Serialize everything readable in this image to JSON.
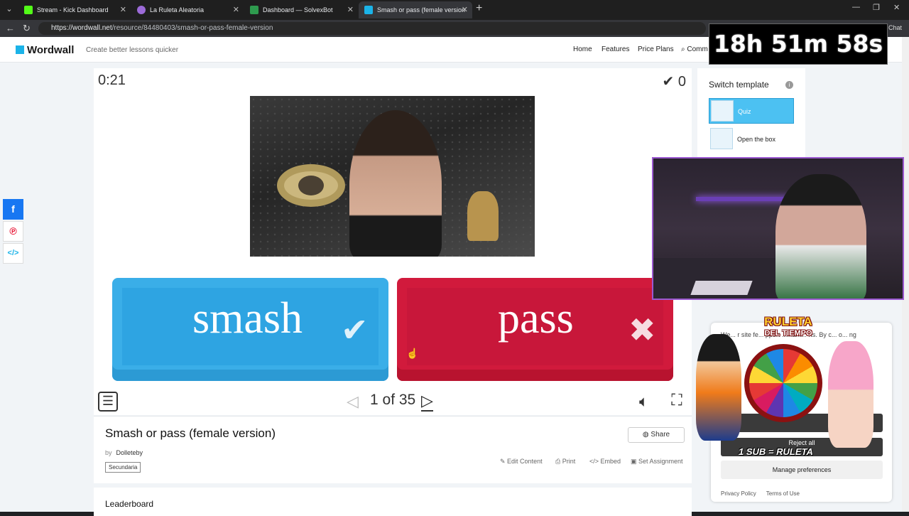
{
  "browser": {
    "tabs": [
      {
        "title": "Stream - Kick Dashboard",
        "color": "#53fc18"
      },
      {
        "title": "La Ruleta Aleatoria",
        "color": "#9c6bd8"
      },
      {
        "title": "Dashboard — SolvexBot",
        "color": "#2e9b4e"
      },
      {
        "title": "Smash or pass (female version",
        "color": "#1bb3e8"
      }
    ],
    "url_host": "https://wordwall.net",
    "url_path": "/resource/84480403/smash-or-pass-female-version",
    "chat_label": "Chat"
  },
  "header": {
    "logo": "Wordwall",
    "tagline": "Create better lessons quicker",
    "menu": [
      "Home",
      "Features",
      "Price Plans",
      "Comm"
    ]
  },
  "activity": {
    "timer": "0:21",
    "score": "0",
    "smash_label": "smash",
    "pass_label": "pass",
    "pager": "1 of 35"
  },
  "resource": {
    "title": "Smash or pass (female version)",
    "by_prefix": "by",
    "author": "Dolleteby",
    "tag": "Secundaria",
    "share": "Share",
    "actions": [
      "Edit Content",
      "Print",
      "Embed",
      "Set Assignment"
    ],
    "leaderboard": "Leaderboard"
  },
  "sidebar": {
    "switch_title": "Switch template",
    "templates": [
      "Quiz",
      "Open the box"
    ]
  },
  "cookie": {
    "text": "We... r site fe... pport ...mark... rts. By c... o... ng",
    "reject_all": "Reject all",
    "manage": "Manage preferences",
    "privacy": "Privacy Policy",
    "terms": "Terms of Use"
  },
  "overlay": {
    "stream_timer": "18h 51m 58s",
    "ruleta_title": "RULETA",
    "ruleta_subtitle": "DEL TIEMPO",
    "ruleta_sub": "1 SUB = RULETA"
  }
}
